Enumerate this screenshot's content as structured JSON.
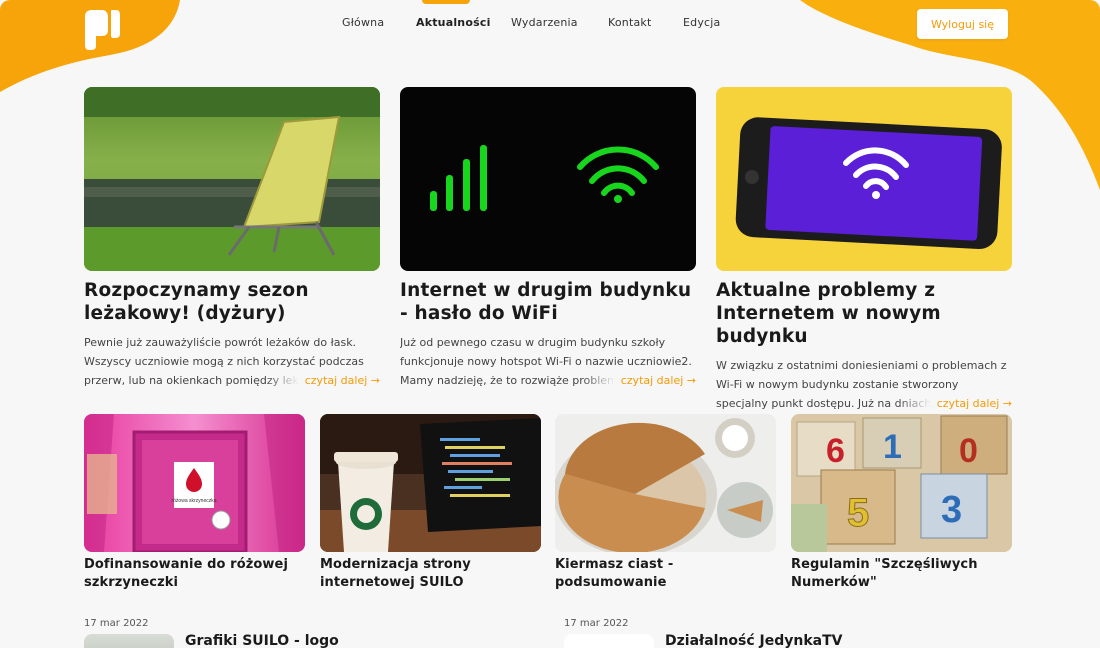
{
  "nav": {
    "items": [
      {
        "label": "Główna"
      },
      {
        "label": "Aktualności"
      },
      {
        "label": "Wydarzenia"
      },
      {
        "label": "Kontakt"
      },
      {
        "label": "Edycja"
      }
    ],
    "logout_label": "Wyloguj się"
  },
  "featured": [
    {
      "title": "Rozpoczynamy sezon leżakowy! (dyżury)",
      "excerpt": "Pewnie już zauważyliście powrót leżaków do łask. Wszyscy uczniowie mogą z nich korzystać podczas przerw, lub na okienkach pomiędzy lekcjami.",
      "read_more": "czytaj dalej →"
    },
    {
      "title": "Internet w drugim budynku - hasło do WiFi",
      "excerpt": "Już od pewnego czasu w drugim budynku szkoły funkcjonuje nowy hotspot Wi-Fi o nazwie uczniowie2. Mamy nadzieję, że to rozwiąże problemy.",
      "read_more": "czytaj dalej →"
    },
    {
      "title": "Aktualne problemy z Internetem w nowym budynku",
      "excerpt": "W związku z ostatnimi doniesieniami o problemach z Wi-Fi w nowym budynku zostanie stworzony specjalny punkt dostępu. Już na dniach.",
      "read_more": "czytaj dalej →"
    }
  ],
  "secondary": [
    {
      "title": "Dofinansowanie do różowej szkrzyneczki",
      "box_label": "różowa skrzyneczka"
    },
    {
      "title": "Modernizacja strony internetowej SUILO"
    },
    {
      "title": "Kiermasz ciast - podsumowanie"
    },
    {
      "title": "Regulamin \"Szczęśliwych Numerków\""
    }
  ],
  "list": [
    {
      "date": "17 mar 2022",
      "title": "Grafiki SUILO - logo"
    },
    {
      "date": "17 mar 2022",
      "title": "Działalność JedynkaTV"
    }
  ],
  "colors": {
    "accent": "#f7a30a",
    "accent_text": "#f59a07",
    "background": "#f7f7f7"
  }
}
